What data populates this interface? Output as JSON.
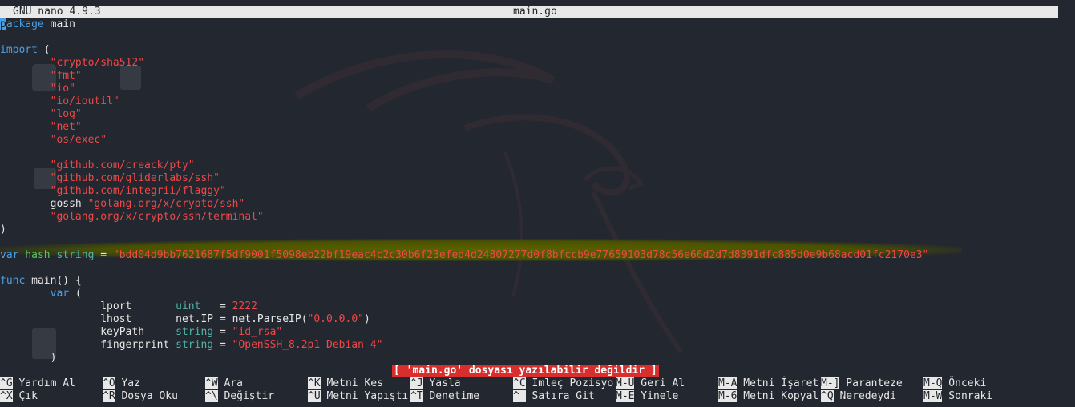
{
  "titlebar": {
    "version": "GNU nano 4.9.3",
    "filename": "main.go"
  },
  "code": {
    "l1_kw": "package",
    "l1_rest": " main",
    "l3_kw": "import",
    "l3_rest": " (",
    "imports": [
      "\"crypto/sha512\"",
      "\"fmt\"",
      "\"io\"",
      "\"io/ioutil\"",
      "\"log\"",
      "\"net\"",
      "\"os/exec\""
    ],
    "imports2": [
      "\"github.com/creack/pty\"",
      "\"github.com/gliderlabs/ssh\"",
      "\"github.com/integrii/flaggy\""
    ],
    "gossh_alias": "gossh ",
    "gossh_path": "\"golang.org/x/crypto/ssh\"",
    "terminal_path": "\"golang.org/x/crypto/ssh/terminal\"",
    "close_paren": ")",
    "var_kw": "var",
    "hash_name": " hash ",
    "string_type": "string",
    "equals": " = ",
    "hash_value": "\"bdd04d9bb7621687f5df9001f5098eb22bf19eac4c2c30b6f23efed4d24807277d0f8bfccb9e77659103d78c56e66d2d7d8391dfc885d0e9b68acd01fc2170e3\"",
    "func_kw": "func",
    "func_rest": " main() {",
    "var_open_kw": "var",
    "var_open_rest": " (",
    "lport_name": "lport       ",
    "lport_type": "uint",
    "lport_eq": "   = ",
    "lport_val": "2222",
    "lhost_name": "lhost       ",
    "lhost_rest": "net.IP = net.ParseIP(",
    "lhost_val": "\"0.0.0.0\"",
    "lhost_close": ")",
    "keypath_name": "keyPath     ",
    "keypath_type": "string",
    "keypath_eq": " = ",
    "keypath_val": "\"id_rsa\"",
    "fp_name": "fingerprint ",
    "fp_type": "string",
    "fp_eq": " = ",
    "fp_val": "\"OpenSSH_8.2p1 Debian-4\"",
    "var_close": ")"
  },
  "status_message": "[ 'main.go' dosyası yazılabilir değildir ]",
  "shortcuts": [
    {
      "key": "^G",
      "label": "Yardım Al"
    },
    {
      "key": "^O",
      "label": "Yaz"
    },
    {
      "key": "^W",
      "label": "Ara"
    },
    {
      "key": "^K",
      "label": "Metni Kes"
    },
    {
      "key": "^J",
      "label": "Yasla"
    },
    {
      "key": "^C",
      "label": "İmleç Pozisyo"
    },
    {
      "key": "M-U",
      "label": "Geri Al"
    },
    {
      "key": "M-A",
      "label": "Metni İşaret"
    },
    {
      "key": "M-]",
      "label": "Paranteze"
    },
    {
      "key": "M-Q",
      "label": "Önceki"
    },
    {
      "key": "^X",
      "label": "Çık"
    },
    {
      "key": "^R",
      "label": "Dosya Oku"
    },
    {
      "key": "^\\",
      "label": "Değiştir"
    },
    {
      "key": "^U",
      "label": "Metni Yapıştı"
    },
    {
      "key": "^T",
      "label": "Denetime"
    },
    {
      "key": "^_",
      "label": "Satıra Git"
    },
    {
      "key": "M-E",
      "label": "Yinele"
    },
    {
      "key": "M-6",
      "label": "Metni Kopyal"
    },
    {
      "key": "^Q",
      "label": "Neredeydi"
    },
    {
      "key": "M-W",
      "label": "Sonraki"
    }
  ],
  "colors": {
    "background": "#23272f",
    "keyword": "#4aa0e6",
    "string": "#ef4848",
    "type": "#4fb3a6",
    "status_bg": "#d92e2e"
  }
}
